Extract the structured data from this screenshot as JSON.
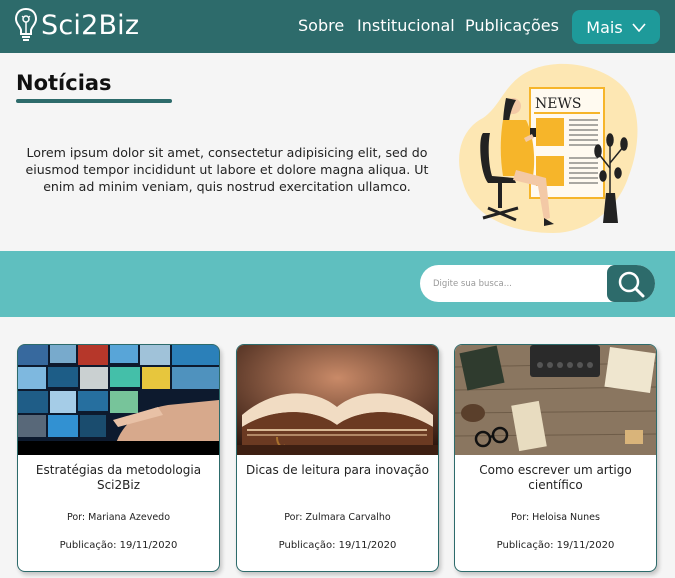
{
  "brand": {
    "name": "Sci2Biz"
  },
  "nav": {
    "items": [
      {
        "label": "Sobre"
      },
      {
        "label": "Institucional"
      },
      {
        "label": "Publicações"
      }
    ],
    "more_label": "Mais",
    "more_icon": "chevron-down-icon"
  },
  "hero": {
    "title": "Notícias",
    "intro": "Lorem ipsum dolor sit amet, consectetur adipisicing elit, sed do eiusmod tempor incididunt ut labore et dolore magna aliqua. Ut enim ad minim veniam, quis nostrud exercitation ullamco.",
    "illustration_text": "NEWS"
  },
  "search": {
    "placeholder": "Digite sua busca...",
    "value": "",
    "icon": "search-icon"
  },
  "cards": [
    {
      "title": "Estratégias da metodologia Sci2Biz",
      "author": "Por: Mariana Azevedo",
      "date": "Publicação: 19/11/2020"
    },
    {
      "title": "Dicas de leitura para inovação",
      "author": "Por: Zulmara Carvalho",
      "date": "Publicação: 19/11/2020"
    },
    {
      "title": "Como escrever um artigo científico",
      "author": "Por: Heloisa Nunes",
      "date": "Publicação: 19/11/2020"
    }
  ],
  "colors": {
    "header": "#2d6b6b",
    "accent": "#1e9a9a",
    "strip": "#5fbfbf",
    "illustration_yellow": "#f6b52a"
  }
}
